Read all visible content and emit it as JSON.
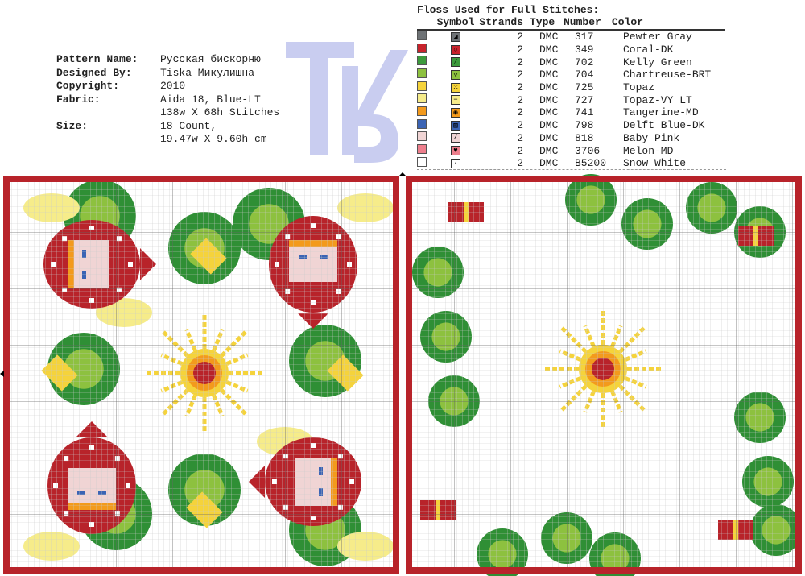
{
  "pattern_info": [
    {
      "label": "Pattern Name:",
      "value": "Русская бискорню"
    },
    {
      "label": "Designed By:",
      "value": "Tiska Микулишна"
    },
    {
      "label": "Copyright:",
      "value": "2010"
    },
    {
      "label": "Fabric:",
      "value": "Aida 18, Blue-LT"
    },
    {
      "label": "",
      "value": "138w X 68h Stitches"
    },
    {
      "label": "Size:",
      "value": "18 Count,"
    },
    {
      "label": "",
      "value": "19.47w X 9.60h cm"
    }
  ],
  "logo_text": "TK",
  "floss": {
    "title": "Floss Used for Full Stitches:",
    "headers": [
      "Symbol",
      "Strands",
      "Type",
      "Number",
      "Color"
    ],
    "rows": [
      {
        "swatch": "#6e7275",
        "strands": "2",
        "type": "DMC",
        "number": "317",
        "color": "Pewter Gray",
        "glyph": "◢"
      },
      {
        "swatch": "#c8232c",
        "strands": "2",
        "type": "DMC",
        "number": "349",
        "color": "Coral-DK",
        "glyph": "○"
      },
      {
        "swatch": "#3c9a3c",
        "strands": "2",
        "type": "DMC",
        "number": "702",
        "color": "Kelly Green",
        "glyph": "⁄"
      },
      {
        "swatch": "#8dc13f",
        "strands": "2",
        "type": "DMC",
        "number": "704",
        "color": "Chartreuse-BRT",
        "glyph": "▽"
      },
      {
        "swatch": "#f5d33b",
        "strands": "2",
        "type": "DMC",
        "number": "725",
        "color": "Topaz",
        "glyph": "⁙"
      },
      {
        "swatch": "#f6ec8a",
        "strands": "2",
        "type": "DMC",
        "number": "727",
        "color": "Topaz-VY LT",
        "glyph": "−"
      },
      {
        "swatch": "#f39a1c",
        "strands": "2",
        "type": "DMC",
        "number": "741",
        "color": "Tangerine-MD",
        "glyph": "◉"
      },
      {
        "swatch": "#3b64b4",
        "strands": "2",
        "type": "DMC",
        "number": "798",
        "color": "Delft Blue-DK",
        "glyph": "▨"
      },
      {
        "swatch": "#f0d4d4",
        "strands": "2",
        "type": "DMC",
        "number": "818",
        "color": "Baby Pink",
        "glyph": "/"
      },
      {
        "swatch": "#ee7f8d",
        "strands": "2",
        "type": "DMC",
        "number": "3706",
        "color": "Melon-MD",
        "glyph": "♥"
      },
      {
        "swatch": "#ffffff",
        "strands": "2",
        "type": "DMC",
        "number": "B5200",
        "color": "Snow White",
        "glyph": "·"
      }
    ]
  },
  "colors": {
    "frame": "#b8232a",
    "green_dark": "#2f8f35",
    "green_light": "#8dc13f",
    "yellow": "#f5d33b",
    "pale_yellow": "#f6ec8a",
    "orange": "#f39a1c",
    "pink": "#f0d4d4",
    "blue": "#3b64b4",
    "grid": "#c9c9c9",
    "logo": "#c9cdf0"
  }
}
